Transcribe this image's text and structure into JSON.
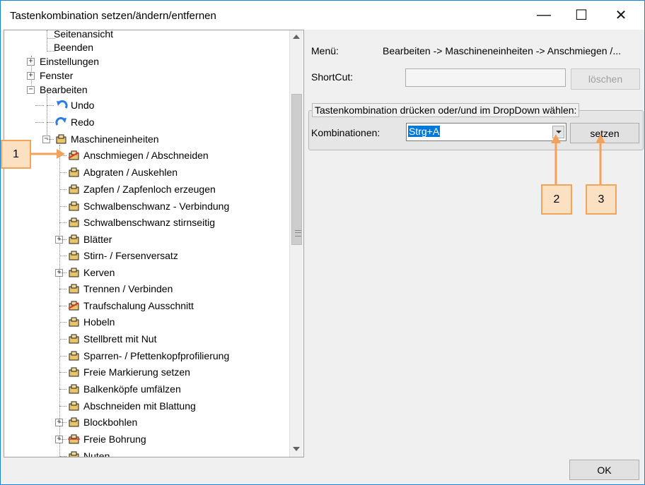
{
  "window": {
    "title": "Tastenkombination setzen/ändern/entfernen",
    "minimize": "—",
    "maximize": "☐",
    "close": "✕"
  },
  "tree": {
    "items": [
      {
        "label": "Seitenansicht",
        "icon": "none"
      },
      {
        "label": "Beenden",
        "icon": "none"
      },
      {
        "label": "Einstellungen",
        "icon": "none"
      },
      {
        "label": "Fenster",
        "icon": "none"
      },
      {
        "label": "Bearbeiten",
        "icon": "none"
      },
      {
        "label": "Undo",
        "icon": "undo-icon"
      },
      {
        "label": "Redo",
        "icon": "redo-icon"
      },
      {
        "label": "Maschineneinheiten",
        "icon": "machine-units-icon"
      },
      {
        "label": "Anschmiegen / Abschneiden",
        "icon": "anschmiegen-icon"
      },
      {
        "label": "Abgraten / Auskehlen",
        "icon": "abgraten-icon"
      },
      {
        "label": "Zapfen / Zapfenloch erzeugen",
        "icon": "zapfen-icon"
      },
      {
        "label": "Schwalbenschwanz - Verbindung",
        "icon": "dovetail-icon"
      },
      {
        "label": "Schwalbenschwanz stirnseitig",
        "icon": "dovetail-end-icon"
      },
      {
        "label": "Blätter",
        "icon": "blaetter-icon"
      },
      {
        "label": "Stirn- / Fersenversatz",
        "icon": "versatz-icon"
      },
      {
        "label": "Kerven",
        "icon": "kerven-icon"
      },
      {
        "label": "Trennen / Verbinden",
        "icon": "trennen-icon"
      },
      {
        "label": "Traufschalung Ausschnitt",
        "icon": "traufschalung-icon"
      },
      {
        "label": "Hobeln",
        "icon": "hobeln-icon"
      },
      {
        "label": "Stellbrett mit Nut",
        "icon": "stellbrett-icon"
      },
      {
        "label": "Sparren- / Pfettenkopfprofilierung",
        "icon": "sparren-icon"
      },
      {
        "label": "Freie Markierung setzen",
        "icon": "markierung-icon"
      },
      {
        "label": "Balkenköpfe umfälzen",
        "icon": "balkenkoepfe-icon"
      },
      {
        "label": "Abschneiden mit Blattung",
        "icon": "blattung-icon"
      },
      {
        "label": "Blockbohlen",
        "icon": "blockbohlen-icon"
      },
      {
        "label": "Freie Bohrung",
        "icon": "bohrung-icon"
      },
      {
        "label": "Nuten",
        "icon": "nuten-icon"
      }
    ]
  },
  "details": {
    "menu_label": "Menü:",
    "menu_value": "Bearbeiten -> Maschineneinheiten -> Anschmiegen /...",
    "shortcut_label": "ShortCut:",
    "shortcut_value": "",
    "delete_button": "löschen",
    "group_title": "Tastenkombination drücken oder/und im DropDown wählen:",
    "combinations_label": "Kombinationen:",
    "combination_value": "Strg+A",
    "set_button": "setzen",
    "ok_button": "OK"
  },
  "callouts": [
    "1",
    "2",
    "3"
  ],
  "colors": {
    "accent": "#0078d7",
    "callout_fill": "#fbe0c2",
    "callout_border": "#f0a55a",
    "arrow": "#f4a25b"
  }
}
